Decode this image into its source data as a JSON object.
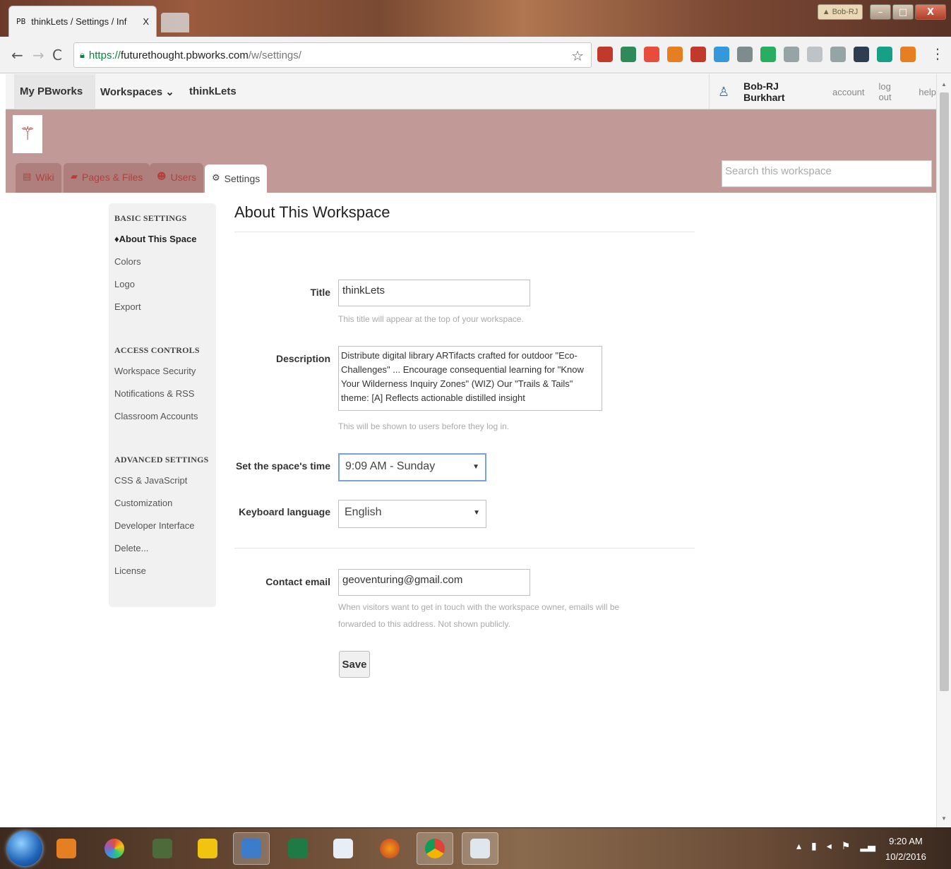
{
  "browser": {
    "tab_title": "thinkLets / Settings / Inf",
    "tab_favicon": "PB",
    "tab_close": "X",
    "profile_chip": "Bob-RJ",
    "url_scheme": "https://",
    "url_host": "futurethought.pbworks.com",
    "url_path": "/w/settings/",
    "extension_colors": [
      "#c0392b",
      "#2e8b57",
      "#e74c3c",
      "#e67e22",
      "#c0392b",
      "#3498db",
      "#7f8c8d",
      "#27ae60",
      "#95a5a6",
      "#bdc3c7",
      "#95a5a6",
      "#2c3e50",
      "#16a085",
      "#e67e22"
    ]
  },
  "pbworks_bar": {
    "my_pbworks": "My PBworks",
    "workspaces": "Workspaces",
    "workspace_name": "thinkLets",
    "user_name": "Bob-RJ Burkhart",
    "account": "account",
    "logout": "log out",
    "help": "help"
  },
  "header": {
    "tabs": [
      {
        "label": "Wiki",
        "icon": "page-icon"
      },
      {
        "label": "Pages & Files",
        "icon": "folder-icon"
      },
      {
        "label": "Users",
        "icon": "user-icon"
      },
      {
        "label": "Settings",
        "icon": "gear-icon"
      }
    ],
    "search_placeholder": "Search this workspace"
  },
  "sidebar": {
    "basic_heading": "BASIC SETTINGS",
    "basic_items": [
      "About This Space",
      "Colors",
      "Logo",
      "Export"
    ],
    "access_heading": "ACCESS CONTROLS",
    "access_items": [
      "Workspace Security",
      "Notifications & RSS",
      "Classroom Accounts"
    ],
    "advanced_heading": "ADVANCED SETTINGS",
    "advanced_items": [
      "CSS & JavaScript",
      "Customization",
      "Developer Interface",
      "Delete...",
      "License"
    ]
  },
  "form": {
    "page_title": "About This Workspace",
    "title_label": "Title",
    "title_value": "thinkLets",
    "title_hint": "This title will appear at the top of your workspace.",
    "description_label": "Description",
    "description_value": "Distribute digital library ARTifacts crafted for outdoor \"Eco-Challenges\" ... Encourage consequential learning for \"Know Your Wilderness Inquiry Zones\" (WIZ) Our \"Trails & Tails\" theme: [A] Reflects actionable distilled insight",
    "description_hint": "This will be shown to users before they log in.",
    "time_label": "Set the space's time",
    "time_value": "9:09 AM - Sunday",
    "language_label": "Keyboard language",
    "language_value": "English",
    "email_label": "Contact email",
    "email_value": "geoventuring@gmail.com",
    "email_hint": "When visitors want to get in touch with the workspace owner, emails will be forwarded to this address. Not shown publicly.",
    "save_label": "Save"
  },
  "taskbar": {
    "clock_time": "9:20 AM",
    "clock_date": "10/2/2016"
  }
}
